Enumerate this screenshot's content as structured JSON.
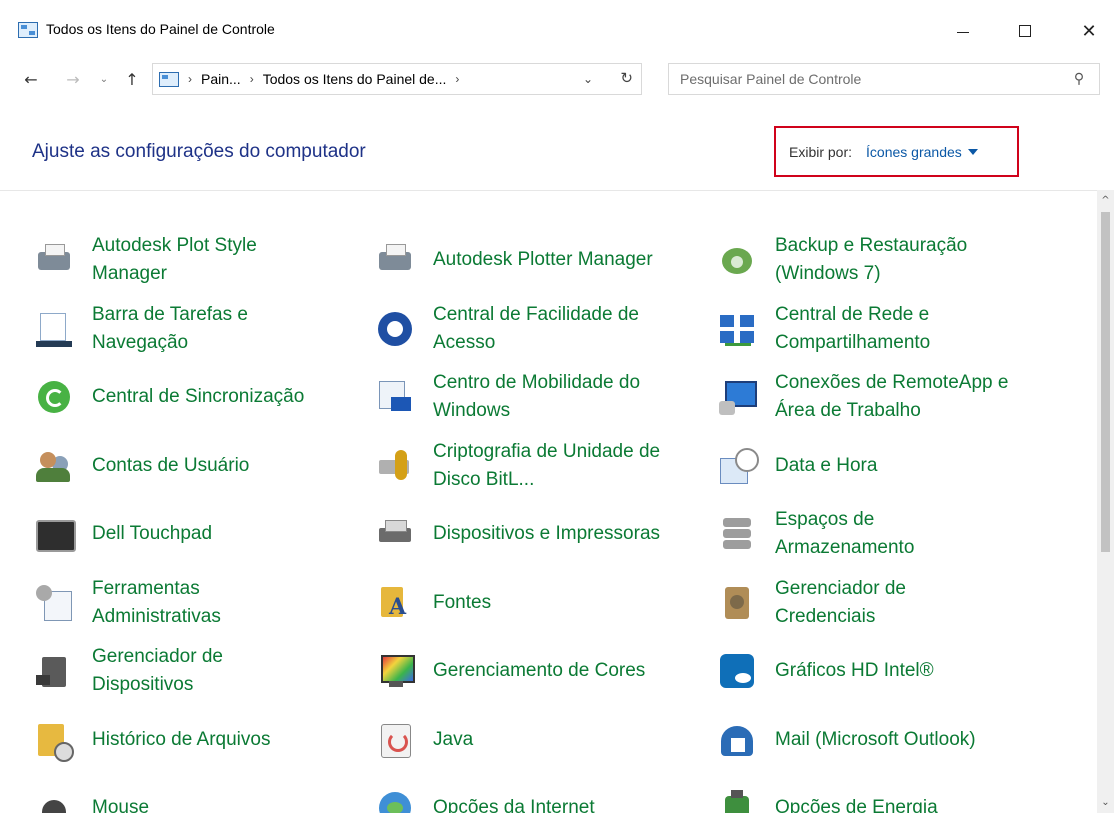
{
  "window": {
    "title": "Todos os Itens do Painel de Controle",
    "minimize_glyph": "—",
    "close_glyph": "✕"
  },
  "nav": {
    "back_glyph": "←",
    "forward_glyph": "→",
    "recent_glyph": "⌄",
    "up_glyph": "↑",
    "address": [
      "Pain...",
      "Todos os Itens do Painel de..."
    ],
    "separator": "›",
    "dropdown_glyph": "⌄",
    "refresh_glyph": "↻"
  },
  "search": {
    "placeholder": "Pesquisar Painel de Controle",
    "value": "",
    "icon_glyph": "⚲"
  },
  "header": {
    "title": "Ajuste as configurações do computador",
    "view_label": "Exibir por:",
    "view_value": "Ícones grandes"
  },
  "scroll": {
    "up_glyph": "^",
    "down_glyph": "⌄"
  },
  "items": [
    {
      "label": "Autodesk Plot Style\nManager",
      "icon": "printer-icon",
      "cls": "ic-printer"
    },
    {
      "label": "Autodesk Plotter Manager",
      "icon": "plotter-icon",
      "cls": "ic-printer"
    },
    {
      "label": "Backup e Restauração\n(Windows 7)",
      "icon": "backup-icon",
      "cls": "ic-backup"
    },
    {
      "label": "Barra de Tarefas e\nNavegação",
      "icon": "taskbar-icon",
      "cls": "ic-taskbar"
    },
    {
      "label": "Central de Facilidade de\nAcesso",
      "icon": "ease-of-access-icon",
      "cls": "ic-ease"
    },
    {
      "label": "Central de Rede e\nCompartilhamento",
      "icon": "network-icon",
      "cls": "ic-network"
    },
    {
      "label": "Central de Sincronização",
      "icon": "sync-icon",
      "cls": "ic-sync"
    },
    {
      "label": "Centro de Mobilidade do\nWindows",
      "icon": "mobility-icon",
      "cls": "ic-mobility"
    },
    {
      "label": "Conexões de RemoteApp e\nÁrea de Trabalho",
      "icon": "remote-desktop-icon",
      "cls": "ic-remote"
    },
    {
      "label": "Contas de Usuário",
      "icon": "users-icon",
      "cls": "ic-users"
    },
    {
      "label": "Criptografia de Unidade de\nDisco BitL...",
      "icon": "bitlocker-icon",
      "cls": "ic-bitlocker"
    },
    {
      "label": "Data e Hora",
      "icon": "clock-icon",
      "cls": "ic-clock"
    },
    {
      "label": "Dell Touchpad",
      "icon": "touchpad-icon",
      "cls": "ic-touchpad"
    },
    {
      "label": "Dispositivos e Impressoras",
      "icon": "devices-icon",
      "cls": "ic-devices"
    },
    {
      "label": "Espaços de\nArmazenamento",
      "icon": "storage-icon",
      "cls": "ic-storage"
    },
    {
      "label": "Ferramentas\nAdministrativas",
      "icon": "admin-tools-icon",
      "cls": "ic-admin"
    },
    {
      "label": "Fontes",
      "icon": "fonts-icon",
      "cls": "ic-fonts"
    },
    {
      "label": "Gerenciador de\nCredenciais",
      "icon": "credentials-icon",
      "cls": "ic-credentials"
    },
    {
      "label": "Gerenciador de\nDispositivos",
      "icon": "device-manager-icon",
      "cls": "ic-devmgr"
    },
    {
      "label": "Gerenciamento de Cores",
      "icon": "color-management-icon",
      "cls": "ic-colors"
    },
    {
      "label": "Gráficos HD Intel®",
      "icon": "intel-graphics-icon",
      "cls": "ic-intel"
    },
    {
      "label": "Histórico de Arquivos",
      "icon": "file-history-icon",
      "cls": "ic-history"
    },
    {
      "label": "Java",
      "icon": "java-icon",
      "cls": "ic-java"
    },
    {
      "label": "Mail (Microsoft Outlook)",
      "icon": "mail-icon",
      "cls": "ic-mail"
    },
    {
      "label": "Mouse",
      "icon": "mouse-icon",
      "cls": "ic-mouse"
    },
    {
      "label": "Opções da Internet",
      "icon": "internet-options-icon",
      "cls": "ic-internet"
    },
    {
      "label": "Opções de Energia",
      "icon": "power-options-icon",
      "cls": "ic-power"
    }
  ],
  "colors": {
    "item_text": "#0b7a34",
    "header_text": "#1e3287",
    "link_blue": "#0b58a6",
    "highlight_border": "#d0021b"
  }
}
